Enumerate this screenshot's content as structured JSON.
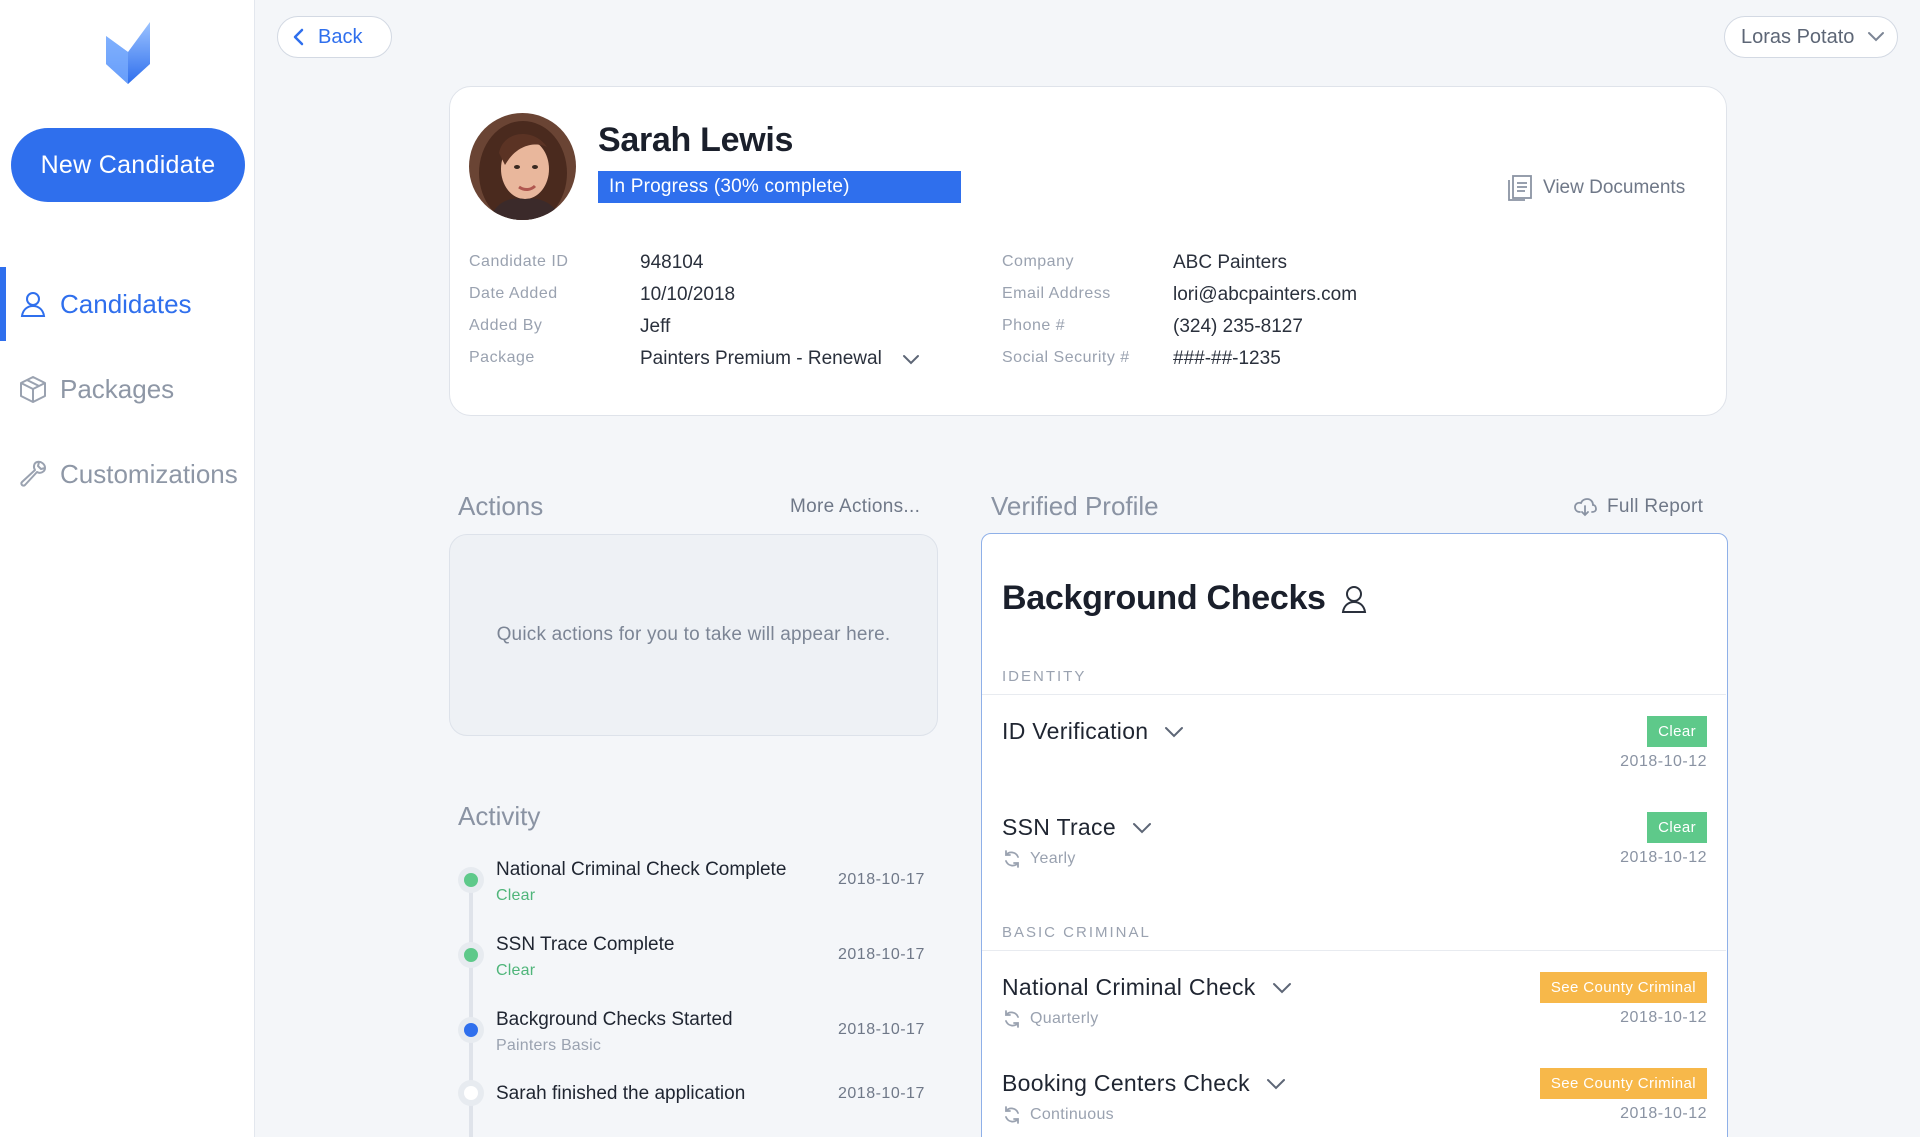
{
  "sidebar": {
    "new_button": "New Candidate",
    "items": [
      {
        "label": "Candidates",
        "icon": "user-icon",
        "active": true
      },
      {
        "label": "Packages",
        "icon": "box-icon",
        "active": false
      },
      {
        "label": "Customizations",
        "icon": "wrench-icon",
        "active": false
      }
    ]
  },
  "topbar": {
    "back_label": "Back",
    "user_name": "Loras Potato"
  },
  "candidate": {
    "name": "Sarah Lewis",
    "status": "In Progress (30% complete)",
    "progress": 0.3,
    "view_documents": "View Documents",
    "left_fields": [
      {
        "label": "Candidate ID",
        "value": "948104"
      },
      {
        "label": "Date Added",
        "value": "10/10/2018"
      },
      {
        "label": "Added By",
        "value": "Jeff"
      },
      {
        "label": "Package",
        "value": "Painters Premium - Renewal"
      }
    ],
    "right_fields": [
      {
        "label": "Company",
        "value": "ABC Painters"
      },
      {
        "label": "Email Address",
        "value": "lori@abcpainters.com"
      },
      {
        "label": "Phone #",
        "value": "(324) 235-8127"
      },
      {
        "label": "Social Security #",
        "value": "###-##-1235"
      }
    ]
  },
  "actions": {
    "title": "Actions",
    "more": "More Actions...",
    "empty": "Quick actions for you to take will appear here."
  },
  "activity": {
    "title": "Activity",
    "items": [
      {
        "title": "National Criminal Check Complete",
        "sub": "Clear",
        "date": "2018-10-17",
        "dot": "#5ec98a",
        "sub_color": "#4fb57a"
      },
      {
        "title": "SSN Trace Complete",
        "sub": "Clear",
        "date": "2018-10-17",
        "dot": "#5ec98a",
        "sub_color": "#4fb57a"
      },
      {
        "title": "Background Checks Started",
        "sub": "Painters Basic",
        "date": "2018-10-17",
        "dot": "#2f6fed",
        "sub_color": "#9aa2b0"
      },
      {
        "title": "Sarah finished the application",
        "sub": "",
        "date": "2018-10-17",
        "dot": "#ffffff",
        "sub_color": "#9aa2b0"
      }
    ]
  },
  "verified": {
    "title": "Verified Profile",
    "full_report": "Full Report",
    "heading": "Background Checks",
    "groups": [
      {
        "label": "IDENTITY"
      },
      {
        "label": "BASIC CRIMINAL"
      }
    ],
    "checks": [
      {
        "name": "ID Verification",
        "badge": "Clear",
        "badge_type": "clear",
        "date": "2018-10-12",
        "freq": ""
      },
      {
        "name": "SSN Trace",
        "badge": "Clear",
        "badge_type": "clear",
        "date": "2018-10-12",
        "freq": "Yearly"
      },
      {
        "name": "National Criminal Check",
        "badge": "See County Criminal",
        "badge_type": "warn",
        "date": "2018-10-12",
        "freq": "Quarterly"
      },
      {
        "name": "Booking Centers Check",
        "badge": "See County Criminal",
        "badge_type": "warn",
        "date": "2018-10-12",
        "freq": "Continuous"
      }
    ]
  },
  "colors": {
    "accent": "#2f6fed",
    "clear": "#5ec98a",
    "warning": "#f7b84a"
  }
}
